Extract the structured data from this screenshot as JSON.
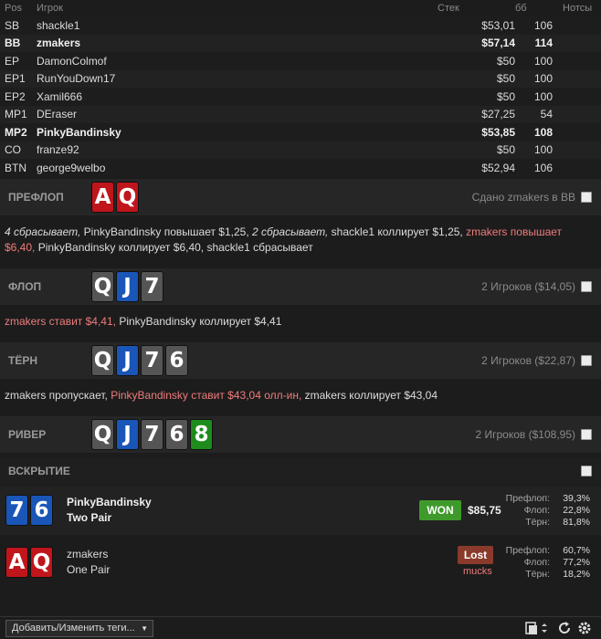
{
  "table": {
    "headers": {
      "pos": "Pos",
      "player": "Игрок",
      "stack": "Стек",
      "bb": "бб",
      "notes": "Нотсы"
    },
    "rows": [
      {
        "pos": "SB",
        "name": "shackle1",
        "stack": "$53,01",
        "bb": "106",
        "bold": false
      },
      {
        "pos": "BB",
        "name": "zmakers",
        "stack": "$57,14",
        "bb": "114",
        "bold": true
      },
      {
        "pos": "EP",
        "name": "DamonColmof",
        "stack": "$50",
        "bb": "100",
        "bold": false
      },
      {
        "pos": "EP1",
        "name": "RunYouDown17",
        "stack": "$50",
        "bb": "100",
        "bold": false
      },
      {
        "pos": "EP2",
        "name": "Xamil666",
        "stack": "$50",
        "bb": "100",
        "bold": false
      },
      {
        "pos": "MP1",
        "name": "DEraser",
        "stack": "$27,25",
        "bb": "54",
        "bold": false
      },
      {
        "pos": "MP2",
        "name": "PinkyBandinsky",
        "stack": "$53,85",
        "bb": "108",
        "bold": true
      },
      {
        "pos": "CO",
        "name": "franze92",
        "stack": "$50",
        "bb": "100",
        "bold": false
      },
      {
        "pos": "BTN",
        "name": "george9welbo",
        "stack": "$52,94",
        "bb": "106",
        "bold": false
      }
    ]
  },
  "preflop": {
    "label": "ПРЕФЛОП",
    "cards": [
      {
        "rank": "A",
        "color": "red"
      },
      {
        "rank": "Q",
        "color": "red"
      }
    ],
    "info": "Сдано zmakers в BB",
    "actions": {
      "a1": "4 сбрасывает,",
      "a2": " PinkyBandinsky повышает $1,25, ",
      "a3": "2 сбрасывает,",
      "a4": " shackle1 коллирует $1,25, ",
      "a5": "zmakers повышает $6,40,",
      "a6": " PinkyBandinsky коллирует $6,40, shackle1 сбрасывает"
    }
  },
  "flop": {
    "label": "ФЛОП",
    "cards": [
      {
        "rank": "Q",
        "color": "grey"
      },
      {
        "rank": "J",
        "color": "blue"
      },
      {
        "rank": "7",
        "color": "grey"
      }
    ],
    "info": "2 Игроков ($14,05)",
    "actions": {
      "a1": "zmakers ставит $4,41,",
      "a2": " PinkyBandinsky коллирует $4,41"
    }
  },
  "turn": {
    "label": "ТЁРН",
    "cards": [
      {
        "rank": "Q",
        "color": "grey"
      },
      {
        "rank": "J",
        "color": "blue"
      },
      {
        "rank": "7",
        "color": "grey"
      },
      {
        "rank": "6",
        "color": "grey"
      }
    ],
    "info": "2 Игроков ($22,87)",
    "actions": {
      "a1": "zmakers пропускает, ",
      "a2": "PinkyBandinsky ставит $43,04 олл-ин,",
      "a3": " zmakers коллирует $43,04"
    }
  },
  "river": {
    "label": "РИВЕР",
    "cards": [
      {
        "rank": "Q",
        "color": "grey"
      },
      {
        "rank": "J",
        "color": "blue"
      },
      {
        "rank": "7",
        "color": "grey"
      },
      {
        "rank": "6",
        "color": "grey"
      },
      {
        "rank": "8",
        "color": "green"
      }
    ],
    "info": "2 Игроков ($108,95)"
  },
  "showdown": {
    "label": "ВСКРЫТИЕ",
    "players": [
      {
        "name": "PinkyBandinsky",
        "hand": "Two Pair",
        "cards": [
          {
            "rank": "7",
            "color": "blue"
          },
          {
            "rank": "6",
            "color": "blue"
          }
        ],
        "result": "WON",
        "amount": "$85,75",
        "eq": [
          {
            "label": "Префлоп:",
            "value": "39,3%"
          },
          {
            "label": "Флоп:",
            "value": "22,8%"
          },
          {
            "label": "Тёрн:",
            "value": "81,8%"
          }
        ]
      },
      {
        "name": "zmakers",
        "hand": "One Pair",
        "cards": [
          {
            "rank": "A",
            "color": "red"
          },
          {
            "rank": "Q",
            "color": "red"
          }
        ],
        "result": "Lost",
        "note": "mucks",
        "eq": [
          {
            "label": "Префлоп:",
            "value": "60,7%"
          },
          {
            "label": "Флоп:",
            "value": "77,2%"
          },
          {
            "label": "Тёрн:",
            "value": "18,2%"
          }
        ]
      }
    ]
  },
  "footer": {
    "tags_label": "Добавить/Изменить теги...",
    "icons": [
      "clipboard-icon",
      "refresh-icon",
      "gear-icon"
    ]
  },
  "colors": {
    "hero_action": "#ef7b7b",
    "won": "#3e9a2a",
    "lost": "#8a3a2a",
    "card_red": "#c0151b",
    "card_blue": "#1a55b8",
    "card_grey": "#555555",
    "card_green": "#1d8c1d"
  }
}
